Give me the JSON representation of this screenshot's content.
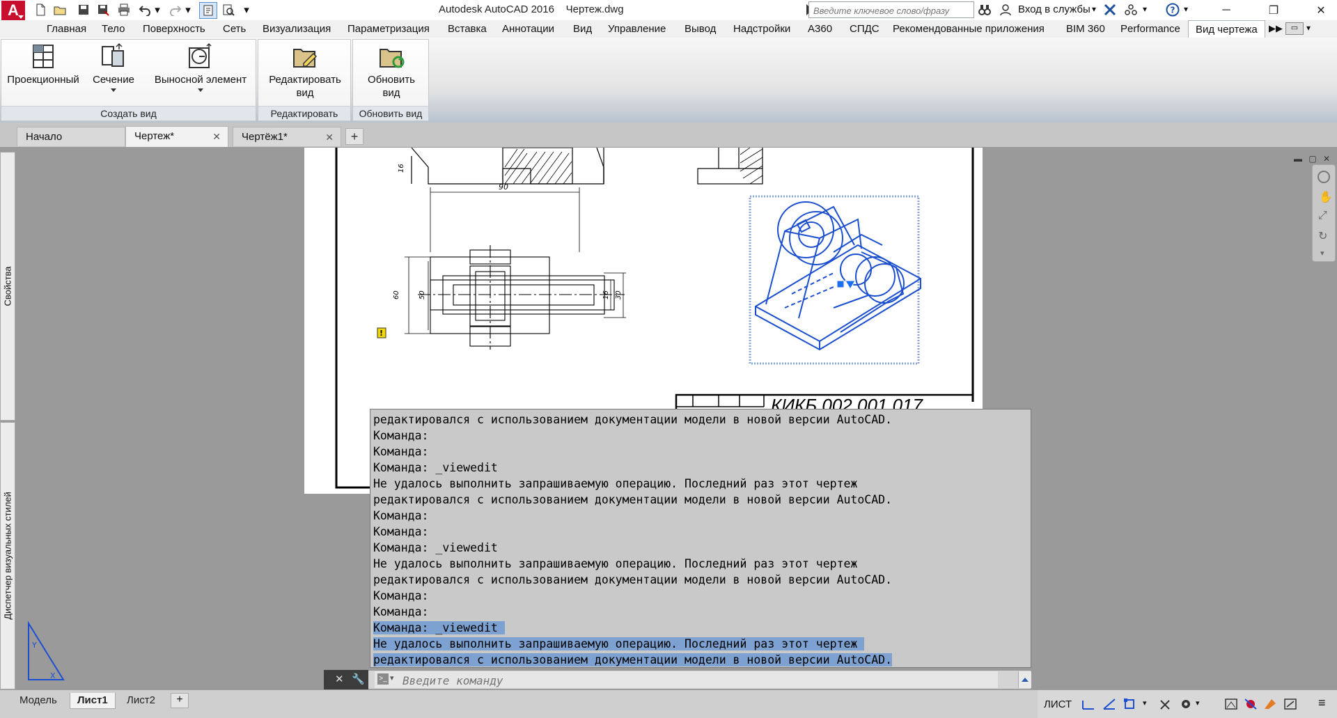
{
  "app": {
    "title": "Autodesk AutoCAD 2016    Чертеж.dwg",
    "search_placeholder": "Введите ключевое слово/фразу",
    "login_label": "Вход в службы",
    "accent": "#c8102e"
  },
  "ribbon_tabs": [
    "Главная",
    "Тело",
    "Поверхность",
    "Сеть",
    "Визуализация",
    "Параметризация",
    "Вставка",
    "Аннотации",
    "Вид",
    "Управление",
    "Вывод",
    "Надстройки",
    "A360",
    "СПДС",
    "Рекомендованные приложения",
    "BIM 360",
    "Performance",
    "Вид чертежа"
  ],
  "ribbon": {
    "create_view": {
      "title": "Создать вид",
      "projected": "Проекционный",
      "section": "Сечение",
      "detail": "Выносной элемент"
    },
    "edit": {
      "title": "Редактировать",
      "edit_view_line1": "Редактировать",
      "edit_view_line2": "вид"
    },
    "update": {
      "title": "Обновить вид",
      "update_view_line1": "Обновить",
      "update_view_line2": "вид"
    }
  },
  "doc_tabs": [
    {
      "label": "Начало"
    },
    {
      "label": "Чертеж*"
    },
    {
      "label": "Чертёж1*"
    }
  ],
  "palettes": {
    "properties": "Свойства",
    "visual_styles": "Диспетчер визуальных стилей"
  },
  "drawing": {
    "dim_top": "90",
    "dim_60": "60",
    "dim_50": "50",
    "dim_16": "16",
    "dim_30": "30",
    "dim_13": "16",
    "title_block_text": "КИКБ.002.001.017"
  },
  "command_history": [
    {
      "text": "редактировался с использованием документации модели в новой версии AutoCAD.",
      "highlight": false
    },
    {
      "text": "Команда:",
      "highlight": false
    },
    {
      "text": "Команда:",
      "highlight": false
    },
    {
      "text": "Команда: _viewedit",
      "highlight": false
    },
    {
      "text": "Не удалось выполнить запрашиваемую операцию. Последний раз этот чертеж",
      "highlight": false
    },
    {
      "text": "редактировался с использованием документации модели в новой версии AutoCAD.",
      "highlight": false
    },
    {
      "text": "Команда:",
      "highlight": false
    },
    {
      "text": "Команда:",
      "highlight": false
    },
    {
      "text": "Команда: _viewedit",
      "highlight": false
    },
    {
      "text": "Не удалось выполнить запрашиваемую операцию. Последний раз этот чертеж",
      "highlight": false
    },
    {
      "text": "редактировался с использованием документации модели в новой версии AutoCAD.",
      "highlight": false
    },
    {
      "text": "Команда:",
      "highlight": false
    },
    {
      "text": "Команда:",
      "highlight": false
    },
    {
      "text": "Команда: _viewedit ",
      "highlight": true
    },
    {
      "text": "Не удалось выполнить запрашиваемую операцию. Последний раз этот чертеж ",
      "highlight": true
    },
    {
      "text": "редактировался с использованием документации модели в новой версии AutoCAD.",
      "highlight": true
    }
  ],
  "command_input_placeholder": "Введите команду",
  "layout_tabs": [
    "Модель",
    "Лист1",
    "Лист2"
  ],
  "status": {
    "space_label": "ЛИСТ"
  }
}
